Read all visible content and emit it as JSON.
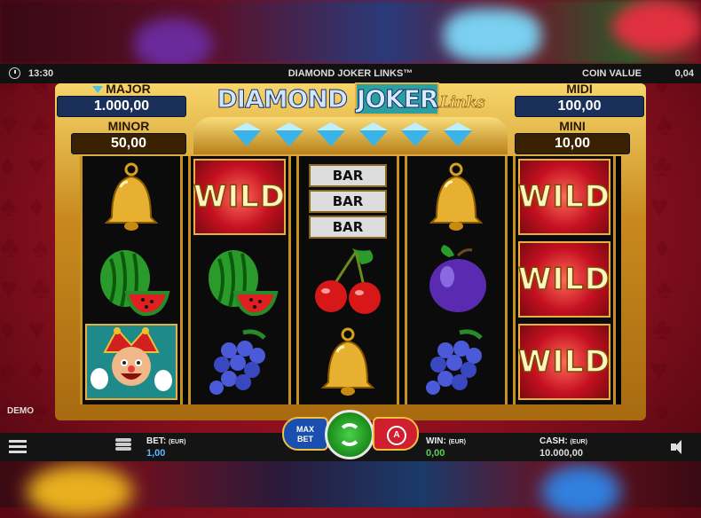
{
  "header": {
    "time": "13:30",
    "title": "DIAMOND JOKER LINKS™",
    "coin_value_label": "COIN VALUE",
    "coin_value": "0,04"
  },
  "logo": {
    "main": "DIAMOND ",
    "joker": "JOKER",
    "links": "Links"
  },
  "jackpots": {
    "major": {
      "label": "MAJOR",
      "value": "1.000,00"
    },
    "minor": {
      "label": "MINOR",
      "value": "50,00"
    },
    "midi": {
      "label": "MIDI",
      "value": "100,00"
    },
    "mini": {
      "label": "MINI",
      "value": "10,00"
    }
  },
  "reels": [
    [
      "bell",
      "watermelon",
      "joker"
    ],
    [
      "wild",
      "watermelon",
      "grapes"
    ],
    [
      "triple-bar",
      "cherries",
      "bell"
    ],
    [
      "bell",
      "plum",
      "grapes"
    ],
    [
      "wild",
      "wild",
      "wild"
    ]
  ],
  "symbols": {
    "wild": "WILD",
    "bar": "BAR"
  },
  "controls": {
    "demo": "DEMO",
    "max_bet_line1": "MAX",
    "max_bet_line2": "BET",
    "auto_label": "A"
  },
  "footer": {
    "bet_label": "BET:",
    "bet_currency": "(EUR)",
    "bet_value": "1,00",
    "win_label": "WIN:",
    "win_currency": "(EUR)",
    "win_value": "0,00",
    "cash_label": "CASH:",
    "cash_currency": "(EUR)",
    "cash_value": "10.000,00"
  },
  "colors": {
    "bet": "#5ab8ff",
    "win": "#5ad05a",
    "felt": "#c0182c",
    "gold": "#c88a1e"
  }
}
